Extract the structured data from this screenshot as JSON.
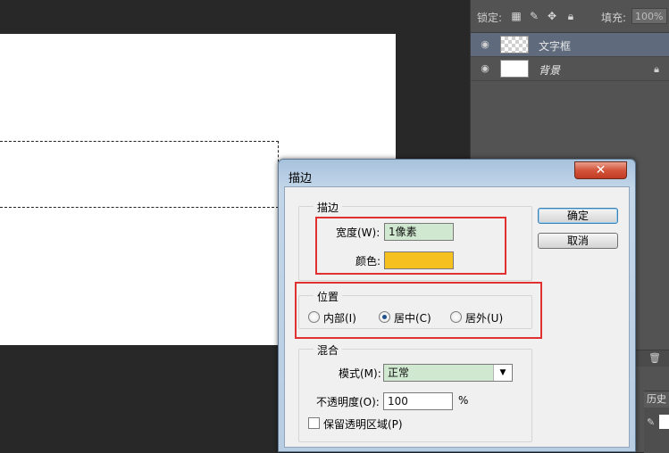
{
  "layers_panel": {
    "lock_label": "锁定:",
    "fill_label": "填充:",
    "fill_value": "100%",
    "layers": [
      {
        "name": "文字框",
        "thumbnail": "transparent-checker",
        "active": true
      },
      {
        "name": "背景",
        "thumbnail": "white",
        "locked": true
      }
    ],
    "history_tab": "历史"
  },
  "dialog": {
    "title": "描边",
    "close_glyph": "✕",
    "stroke_group": {
      "legend": "描边",
      "width_label": "宽度(W):",
      "width_value": "1像素",
      "color_label": "颜色:",
      "color_value": "#f6c01f"
    },
    "position_group": {
      "legend": "位置",
      "options": [
        {
          "label": "内部(I)",
          "checked": false
        },
        {
          "label": "居中(C)",
          "checked": true
        },
        {
          "label": "居外(U)",
          "checked": false
        }
      ]
    },
    "blend_group": {
      "legend": "混合",
      "mode_label": "模式(M):",
      "mode_value": "正常",
      "opacity_label": "不透明度(O):",
      "opacity_value": "100",
      "opacity_unit": "%",
      "preserve_label": "保留透明区域(P)"
    },
    "ok_label": "确定",
    "cancel_label": "取消"
  },
  "annotation_color": "#e03030"
}
